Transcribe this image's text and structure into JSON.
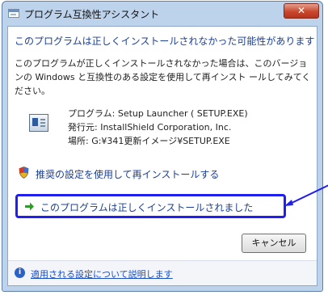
{
  "window": {
    "title": "プログラム互換性アシスタント",
    "close_glyph": "✕"
  },
  "main": {
    "heading": "このプログラムは正しくインストールされなかった可能性があります",
    "description": "このプログラムが正しくインストールされなかった場合は、このバージョンの Windows と互換性のある設定を使用して再インスト ールしてみてください。",
    "program_line": "プログラム: Setup Launcher ( SETUP.EXE)",
    "publisher_line": "発行元: InstallShield Corporation, Inc.",
    "location_line": "場所: G:¥341更新イメージ¥SETUP.EXE"
  },
  "options": [
    {
      "label": "推奨の設定を使用して再インストールする",
      "icon": "shield-icon"
    },
    {
      "label": "このプログラムは正しくインストールされました",
      "icon": "green-arrow-icon"
    }
  ],
  "buttons": {
    "cancel": "キャンセル"
  },
  "footer": {
    "link": "適用される設定について説明します",
    "icon": "info-icon"
  },
  "colors": {
    "heading_blue": "#1c3f94",
    "highlight_border": "#1f1ff2",
    "green_arrow": "#2e9a2a",
    "link_blue": "#1d4fc4"
  }
}
